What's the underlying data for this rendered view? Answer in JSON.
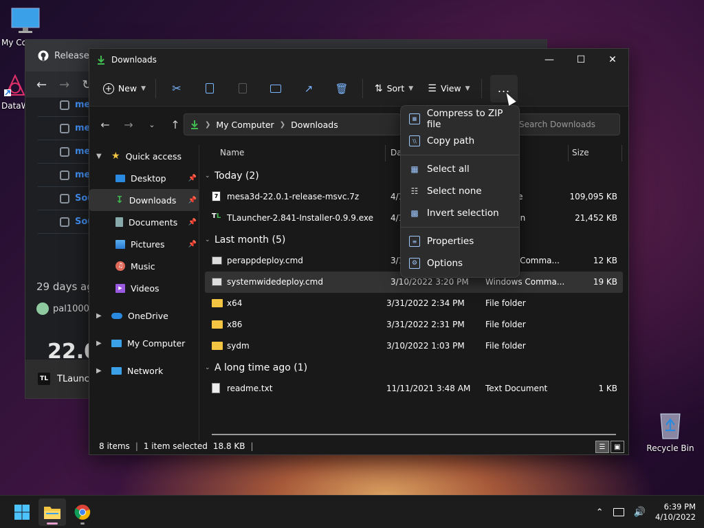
{
  "desktop": {
    "icons": [
      {
        "label": "My Co"
      },
      {
        "label": "DataW"
      },
      {
        "label": "Recycle Bin"
      }
    ]
  },
  "browser": {
    "tab_title": "Releases",
    "rows": [
      "me",
      "me",
      "me",
      "me",
      "Sou",
      "Sou"
    ],
    "time_ago": "29 days ag",
    "user": "pal1000",
    "version": "22.0",
    "task_item": "TLaunch"
  },
  "explorer": {
    "title": "Downloads",
    "toolbar": {
      "new_label": "New",
      "sort_label": "Sort",
      "view_label": "View",
      "more_label": "..."
    },
    "breadcrumb": [
      "My Computer",
      "Downloads"
    ],
    "search_placeholder": "Search Downloads",
    "sidebar": {
      "quick_access": "Quick access",
      "items": [
        {
          "label": "Desktop",
          "pinned": true
        },
        {
          "label": "Downloads",
          "pinned": true,
          "selected": true
        },
        {
          "label": "Documents",
          "pinned": true
        },
        {
          "label": "Pictures",
          "pinned": true
        },
        {
          "label": "Music",
          "pinned": false
        },
        {
          "label": "Videos",
          "pinned": false
        }
      ],
      "onedrive": "OneDrive",
      "my_computer": "My Computer",
      "network": "Network"
    },
    "columns": {
      "name": "Name",
      "date": "Da",
      "size": "Size"
    },
    "groups": [
      {
        "header": "Today (2)",
        "files": [
          {
            "name": "mesa3d-22.0.1-release-msvc.7z",
            "date": "4/1",
            "type": "ve",
            "size": "109,095 KB"
          },
          {
            "name": "TLauncher-2.841-Installer-0.9.9.exe",
            "date": "4/1",
            "type": "ion",
            "size": "21,452 KB"
          }
        ]
      },
      {
        "header": "Last month (5)",
        "files": [
          {
            "name": "perappdeploy.cmd",
            "date": "3/1",
            "type": "s Comma...",
            "size": "12 KB"
          },
          {
            "name": "systemwidedeploy.cmd",
            "date": "3/10/2022 3:20 PM",
            "type": "Windows Comma...",
            "size": "19 KB"
          },
          {
            "name": "x64",
            "date": "3/31/2022 2:34 PM",
            "type": "File folder",
            "size": ""
          },
          {
            "name": "x86",
            "date": "3/31/2022 2:31 PM",
            "type": "File folder",
            "size": ""
          },
          {
            "name": "sydm",
            "date": "3/10/2022 1:03 PM",
            "type": "File folder",
            "size": ""
          }
        ]
      },
      {
        "header": "A long time ago (1)",
        "files": [
          {
            "name": "readme.txt",
            "date": "11/11/2021 3:48 AM",
            "type": "Text Document",
            "size": "1 KB"
          }
        ]
      }
    ],
    "status": {
      "items": "8 items",
      "selected": "1 item selected",
      "size": "18.8 KB",
      "sep": "|"
    },
    "menu": {
      "items": [
        {
          "label": "Compress to ZIP file",
          "icon": "zip-icon"
        },
        {
          "label": "Copy path",
          "icon": "copy-path-icon"
        },
        {
          "label": "Select all",
          "icon": "select-all-icon"
        },
        {
          "label": "Select none",
          "icon": "select-none-icon"
        },
        {
          "label": "Invert selection",
          "icon": "invert-selection-icon"
        },
        {
          "label": "Properties",
          "icon": "properties-icon"
        },
        {
          "label": "Options",
          "icon": "options-icon"
        }
      ]
    }
  },
  "taskbar": {
    "time": "6:39 PM",
    "date": "4/10/2022"
  },
  "colors": {
    "accent": "#4cc2ff",
    "folder": "#f4c542",
    "download_green": "#3fb950"
  }
}
